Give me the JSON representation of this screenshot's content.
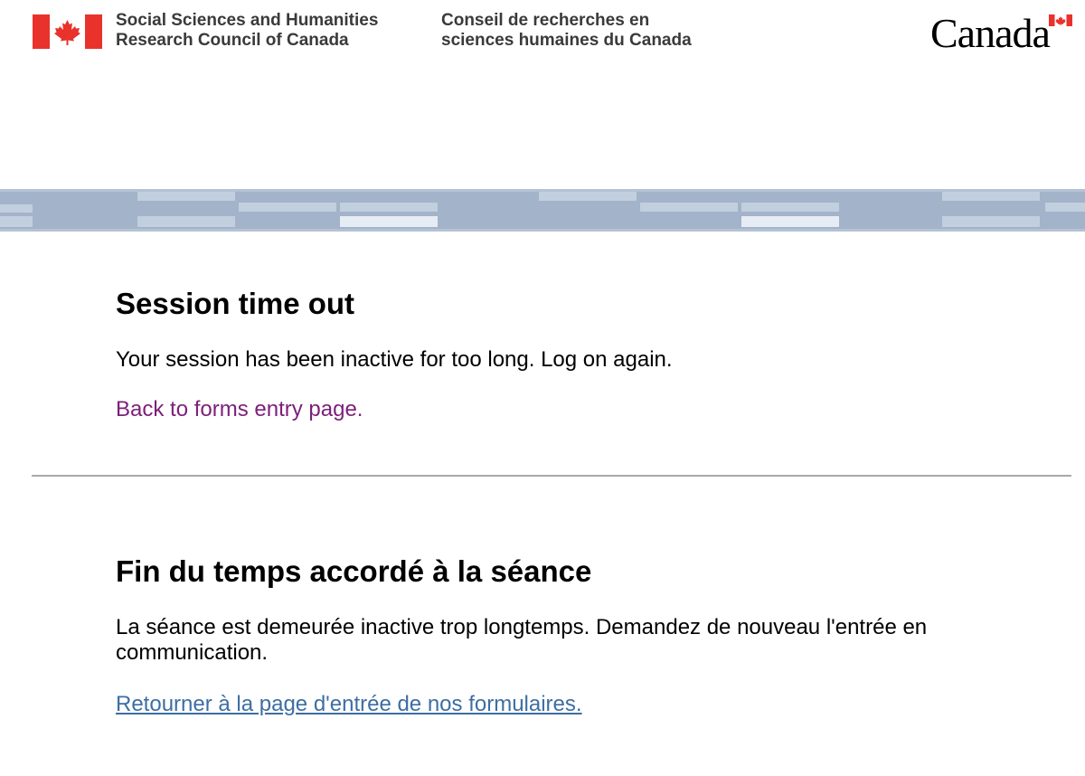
{
  "header": {
    "department_en": [
      "Social Sciences and Humanities",
      "Research Council of Canada"
    ],
    "department_fr": [
      "Conseil de recherches en",
      "sciences humaines du Canada"
    ],
    "wordmark": "Canada",
    "flag_icon": "canada-flag-icon",
    "colors": {
      "flag_red": "#e8322b",
      "text": "#3a3a3a"
    }
  },
  "band": {
    "colors": {
      "base": "#a3b3c9",
      "light": "#c2cfdf",
      "highlight": "#e6ecf3"
    }
  },
  "english": {
    "title": "Session time out",
    "message": "Your session has been inactive for too long. Log on again.",
    "link": "Back to forms entry page."
  },
  "french": {
    "title": "Fin du temps accordé à la séance",
    "message": "La séance est demeurée inactive trop longtemps. Demandez de nouveau l'entrée en communication.",
    "link": "Retourner à la page d'entrée de nos formulaires."
  },
  "colors": {
    "visited_link": "#7d1f7a",
    "link": "#3d6ea3",
    "divider": "#a9a9a9"
  }
}
